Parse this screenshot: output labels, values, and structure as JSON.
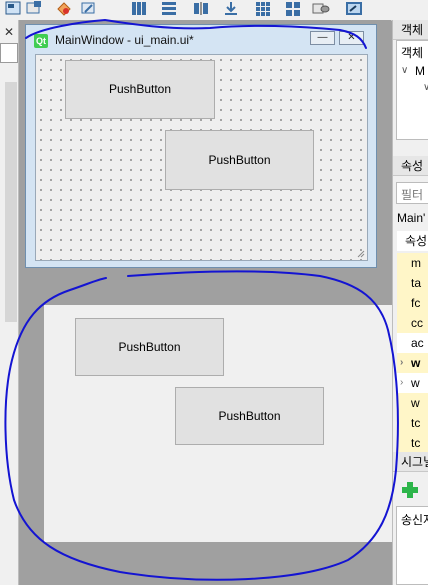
{
  "toolbar": {
    "icons": [
      "widget-edit-icon",
      "tab-order-icon",
      "buddy-icon",
      "signal-slot-icon",
      "layout-horizontal-icon",
      "layout-vertical-icon",
      "layout-splitter-icon",
      "layout-form-icon",
      "layout-grid-icon",
      "break-layout-icon",
      "adjust-size-icon",
      "preview-icon"
    ]
  },
  "left_strip": {
    "close_glyph": "✕"
  },
  "main_window": {
    "title": "MainWindow - ui_main.ui*",
    "logo_text": "Qt",
    "minimize_glyph": "—",
    "close_glyph": "✕",
    "buttons": [
      {
        "label": "PushButton"
      },
      {
        "label": "PushButton"
      }
    ]
  },
  "preview": {
    "buttons": [
      {
        "label": "PushButton"
      },
      {
        "label": "PushButton"
      }
    ]
  },
  "right_panel": {
    "object_inspector_title": "객체",
    "object_header": "객체",
    "object_item": "M",
    "property_editor_title": "속성",
    "filter_placeholder": "필터",
    "class_label": "Main'",
    "property_header": "속성",
    "properties": [
      {
        "name": "m",
        "bold": false
      },
      {
        "name": "ta",
        "bold": false
      },
      {
        "name": "fc",
        "bold": false
      },
      {
        "name": "cc",
        "bold": false
      },
      {
        "name": "ac",
        "bold": false
      },
      {
        "name": "w",
        "bold": true
      },
      {
        "name": "w",
        "bold": false
      },
      {
        "name": "w",
        "bold": false
      },
      {
        "name": "tc",
        "bold": false
      },
      {
        "name": "tc",
        "bold": false
      }
    ],
    "signal_slot_title": "시그널",
    "sender_header": "송신자"
  },
  "colors": {
    "annotation_stroke": "#1414d2",
    "qt_green": "#41cd52",
    "property_highlight": "#fff6c8"
  }
}
